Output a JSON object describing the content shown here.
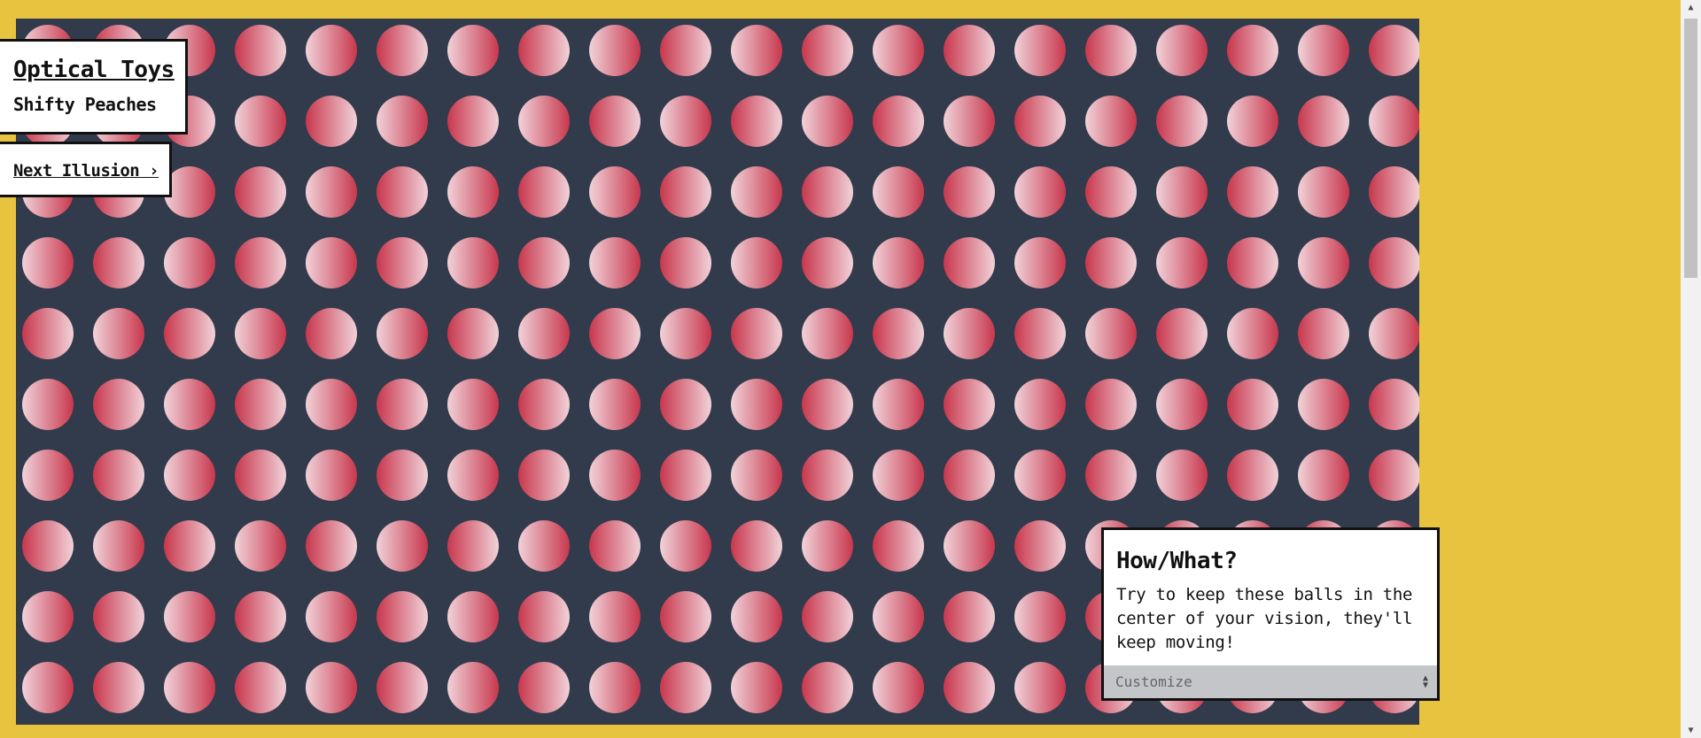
{
  "brand": {
    "title": "Optical Toys",
    "subtitle": "Shifty Peaches"
  },
  "nav": {
    "next_label": "Next Illusion ›"
  },
  "info": {
    "heading": "How/What?",
    "body": "Try to keep these balls in the center of your vision, they'll keep moving!",
    "customize_label": "Customize"
  },
  "illusion": {
    "rows": 10,
    "cols": 20,
    "background": "#323b4b",
    "ball_dark": "#c8374d",
    "ball_light": "#f1d2d9"
  },
  "colors": {
    "page_bg": "#e8c33f",
    "scrollbar_thumb": "#c1c1c1"
  }
}
